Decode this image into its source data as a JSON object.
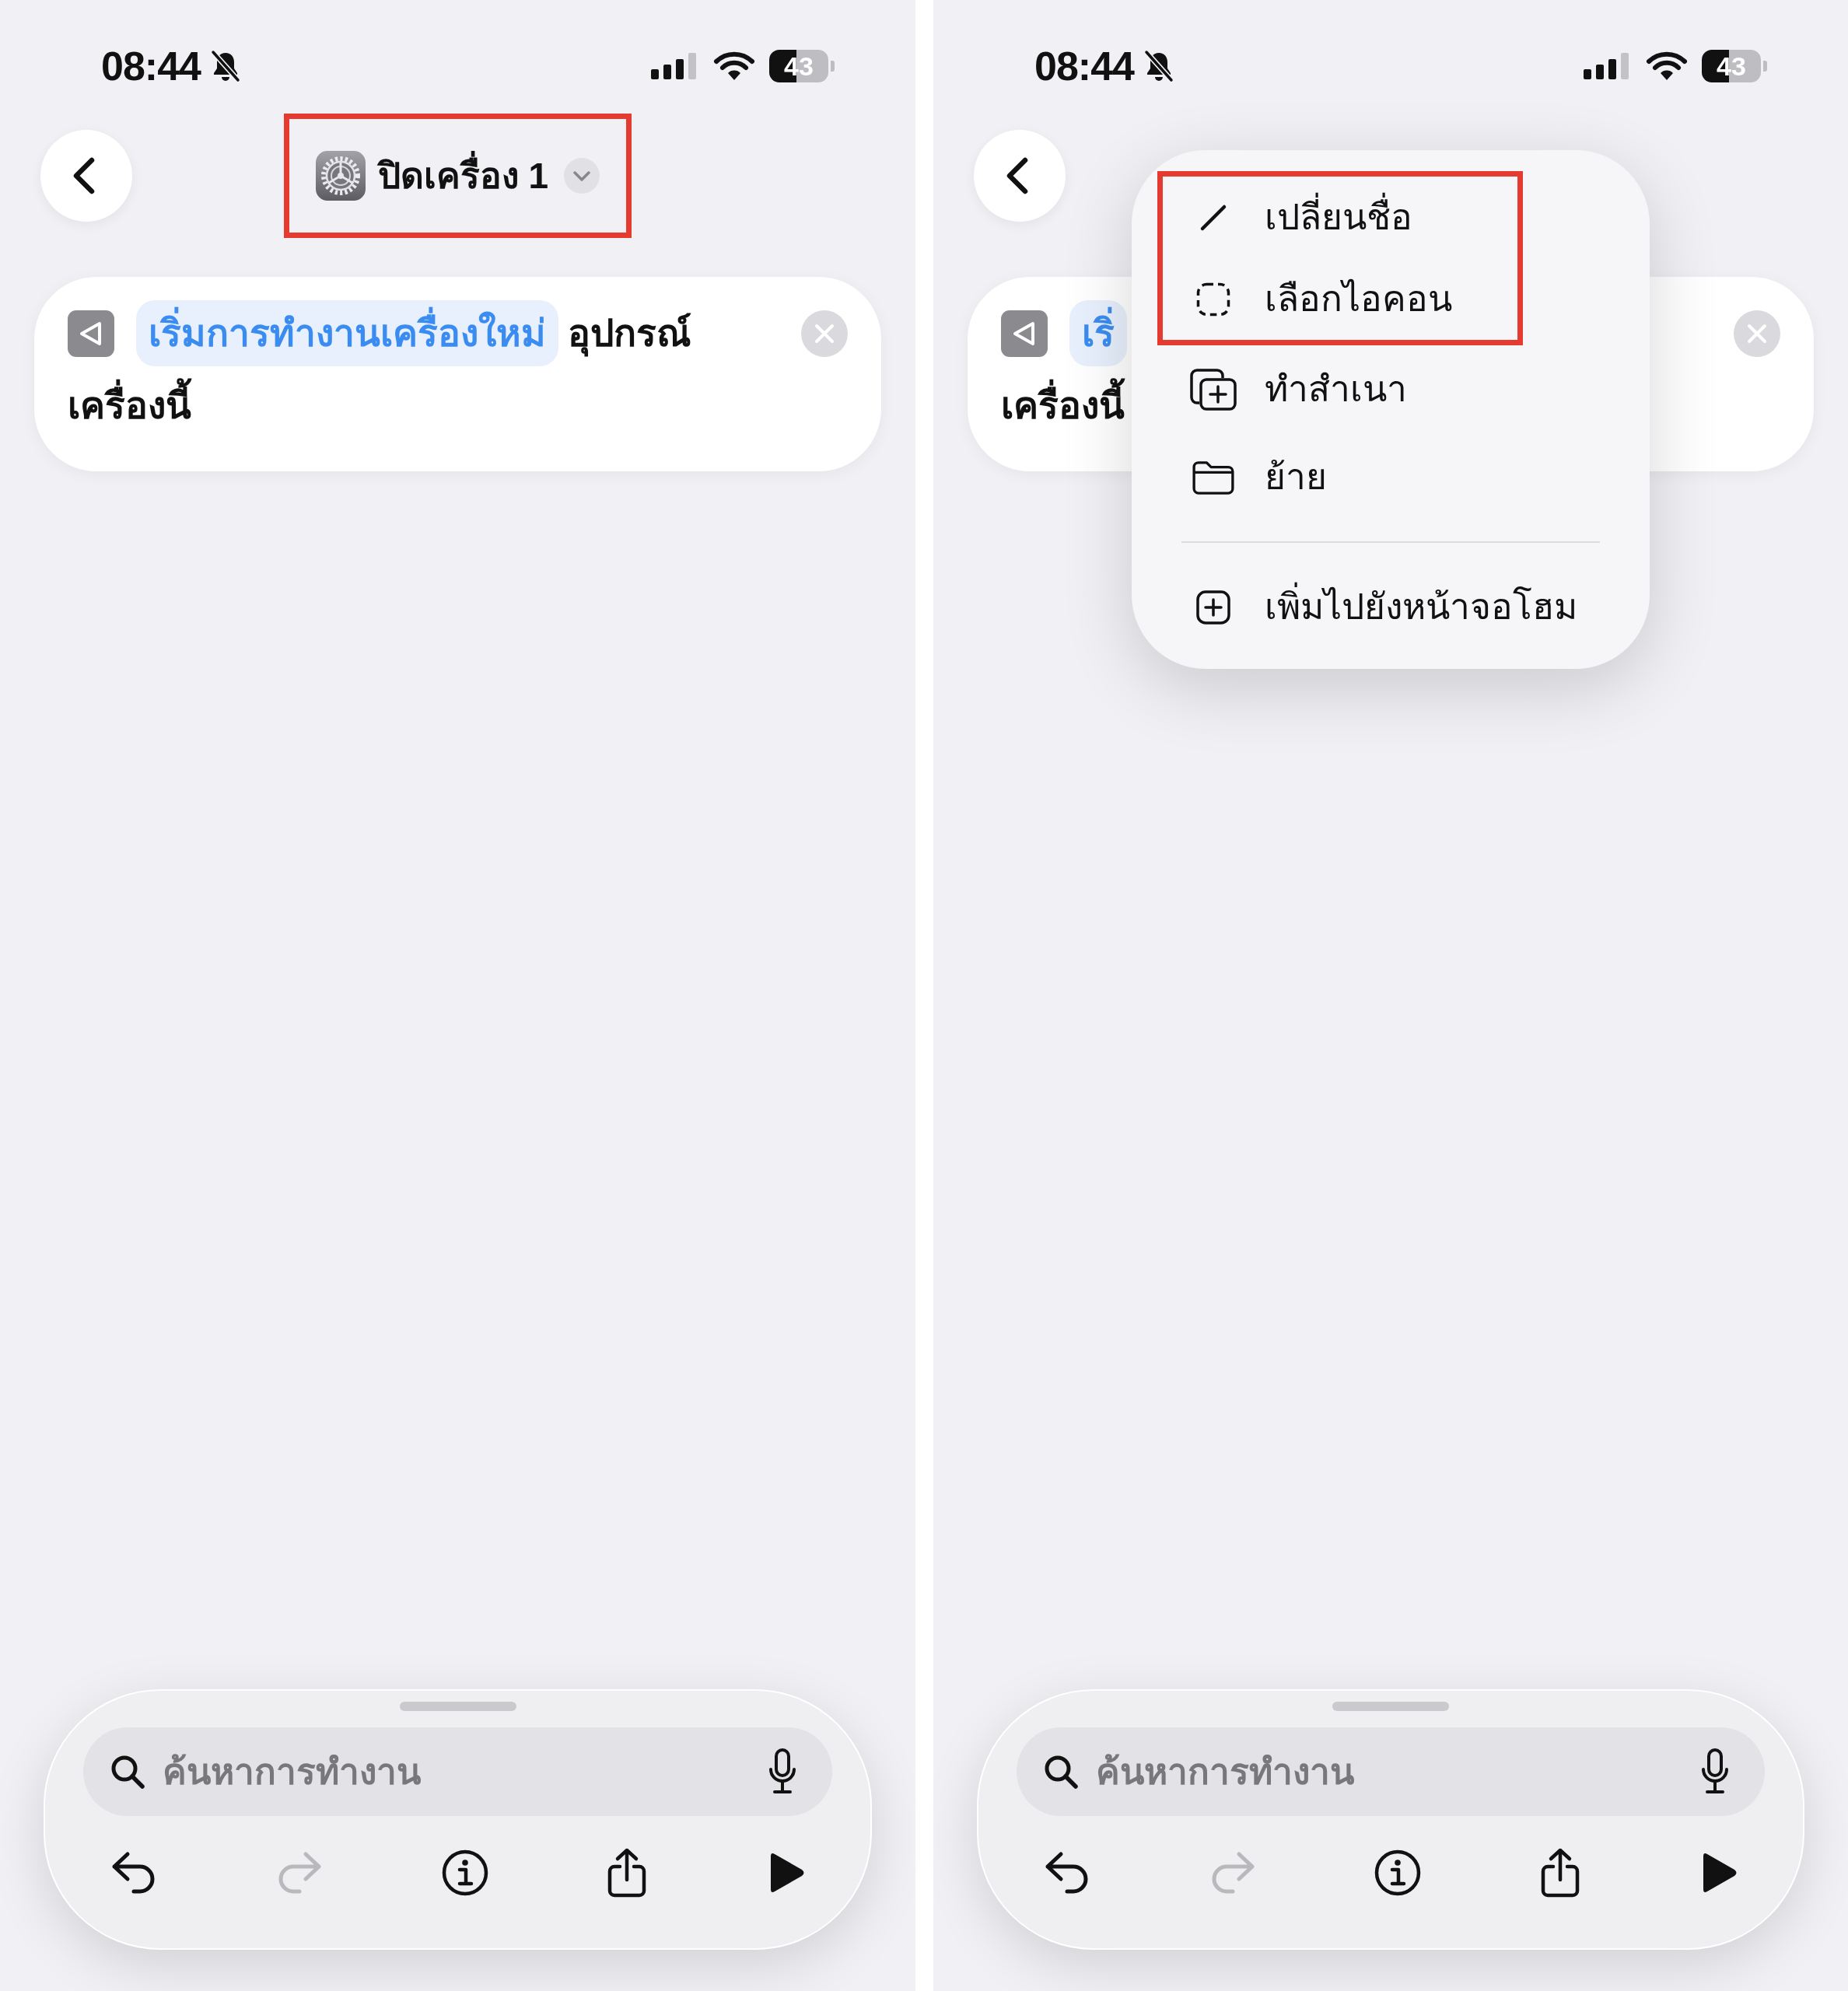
{
  "screens": [
    {
      "status_bar": {
        "time": "08:44",
        "battery": "43"
      },
      "title": {
        "text": "ปิดเครื่อง 1",
        "framed": true
      },
      "action_card": {
        "action": "เริ่มการทำงานเครื่องใหม่",
        "text": "อุปกรณ์",
        "text_continued": "เครื่องนี้"
      },
      "search": {
        "placeholder": "ค้นหาการทำงาน"
      },
      "toolbar": [
        {
          "kind": "undo",
          "disabled": false
        },
        {
          "kind": "redo",
          "disabled": true
        },
        {
          "kind": "info",
          "disabled": false
        },
        {
          "kind": "share",
          "disabled": false
        },
        {
          "kind": "run",
          "disabled": false
        }
      ]
    },
    {
      "status_bar": {
        "time": "08:44",
        "battery": "43"
      },
      "action_card": {
        "action": "เริ่",
        "text_continued": "เครื่องนี้"
      },
      "menu": {
        "sections": [
          {
            "items": [
              {
                "kind": "rename",
                "label": "เปลี่ยนชื่อ",
                "framed": true
              },
              {
                "kind": "icon",
                "label": "เลือกไอคอน",
                "framed": true
              },
              {
                "kind": "duplicate",
                "label": "ทำสำเนา",
                "framed": false
              },
              {
                "kind": "move",
                "label": "ย้าย",
                "framed": false
              }
            ]
          },
          {
            "items": [
              {
                "kind": "add",
                "label": "เพิ่มไปยังหน้าจอโฮม",
                "framed": false
              }
            ]
          }
        ]
      },
      "search": {
        "placeholder": "ค้นหาการทำงาน"
      },
      "toolbar": [
        {
          "kind": "undo",
          "disabled": false
        },
        {
          "kind": "redo",
          "disabled": true
        },
        {
          "kind": "info",
          "disabled": false
        },
        {
          "kind": "share",
          "disabled": false
        },
        {
          "kind": "run",
          "disabled": false
        }
      ]
    }
  ]
}
